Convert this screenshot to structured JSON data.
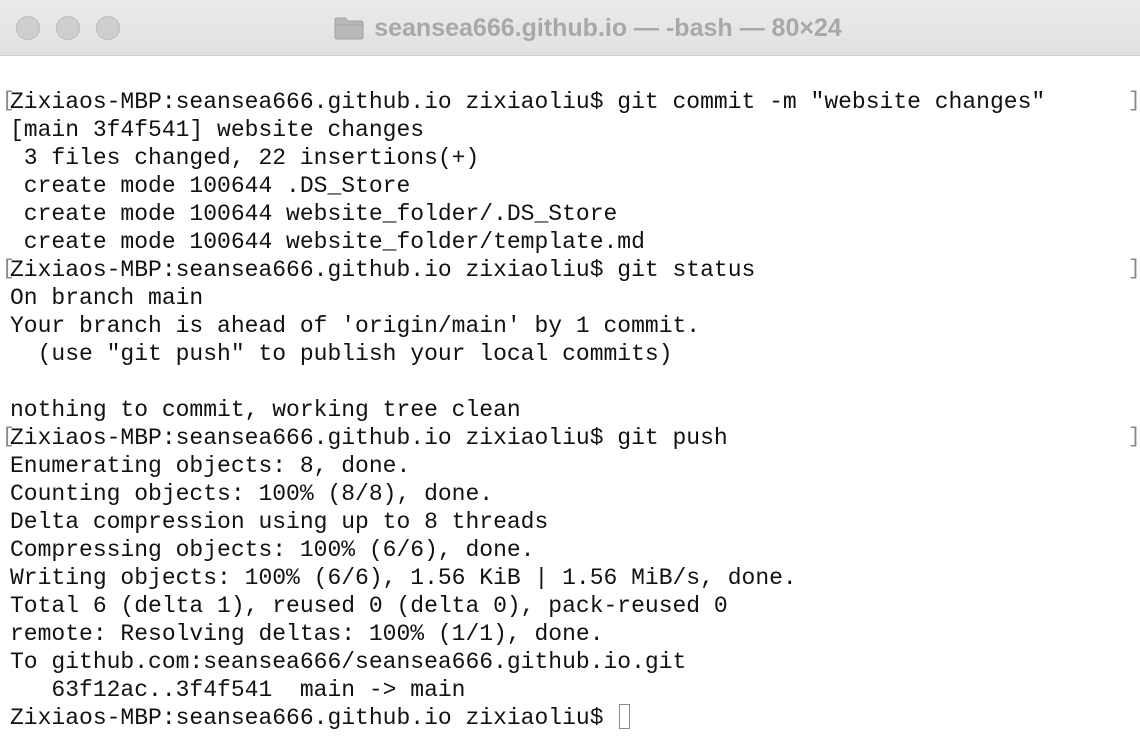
{
  "window": {
    "title": "seansea666.github.io — -bash — 80×24"
  },
  "icons": {
    "title_folder": "folder-icon",
    "close": "close-button-icon",
    "minimize": "minimize-button-icon",
    "zoom": "zoom-button-icon"
  },
  "terminal": {
    "prompt_mark_left": "[",
    "prompt_mark_right": "]",
    "lines": [
      "Zixiaos-MBP:seansea666.github.io zixiaoliu$ git commit -m \"website changes\"",
      "[main 3f4f541] website changes",
      " 3 files changed, 22 insertions(+)",
      " create mode 100644 .DS_Store",
      " create mode 100644 website_folder/.DS_Store",
      " create mode 100644 website_folder/template.md",
      "Zixiaos-MBP:seansea666.github.io zixiaoliu$ git status",
      "On branch main",
      "Your branch is ahead of 'origin/main' by 1 commit.",
      "  (use \"git push\" to publish your local commits)",
      "",
      "nothing to commit, working tree clean",
      "Zixiaos-MBP:seansea666.github.io zixiaoliu$ git push",
      "Enumerating objects: 8, done.",
      "Counting objects: 100% (8/8), done.",
      "Delta compression using up to 8 threads",
      "Compressing objects: 100% (6/6), done.",
      "Writing objects: 100% (6/6), 1.56 KiB | 1.56 MiB/s, done.",
      "Total 6 (delta 1), reused 0 (delta 0), pack-reused 0",
      "remote: Resolving deltas: 100% (1/1), done.",
      "To github.com:seansea666/seansea666.github.io.git",
      "   63f12ac..3f4f541  main -> main",
      "Zixiaos-MBP:seansea666.github.io zixiaoliu$ "
    ]
  }
}
